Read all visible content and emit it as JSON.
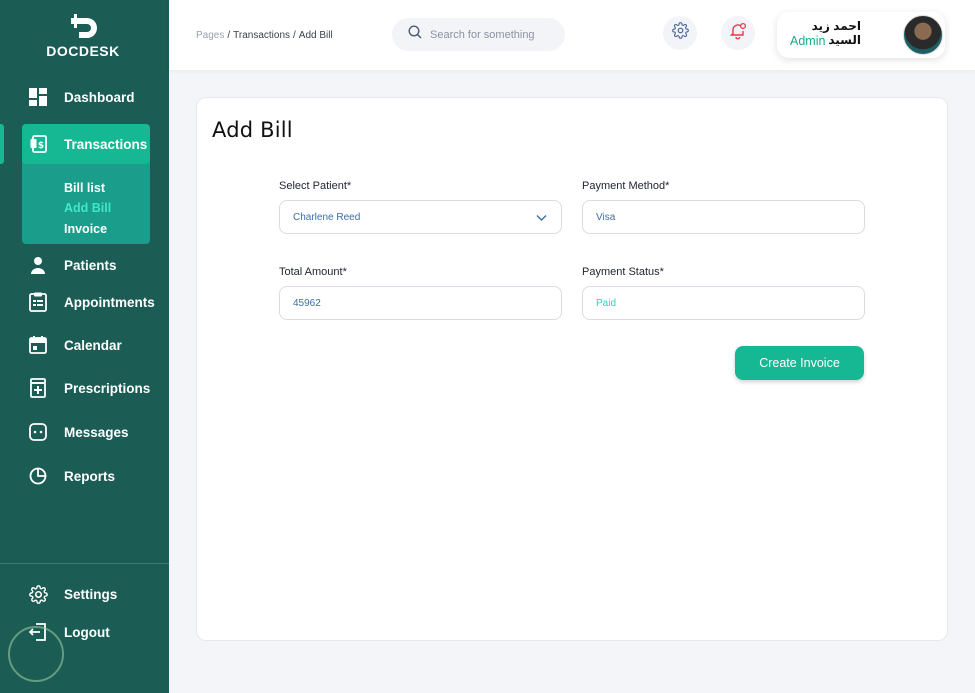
{
  "brand": {
    "name": "DOCDESK"
  },
  "sidebar": {
    "items": [
      {
        "label": "Dashboard",
        "icon": "dashboard-icon"
      },
      {
        "label": "Transactions",
        "icon": "transactions-icon"
      },
      {
        "label": "Patients",
        "icon": "user-icon"
      },
      {
        "label": "Appointments",
        "icon": "clipboard-icon"
      },
      {
        "label": "Calendar",
        "icon": "calendar-icon"
      },
      {
        "label": "Prescriptions",
        "icon": "prescription-icon"
      },
      {
        "label": "Messages",
        "icon": "message-icon"
      },
      {
        "label": "Reports",
        "icon": "pie-chart-icon"
      }
    ],
    "sub_items": [
      {
        "label": "Bill list"
      },
      {
        "label": "Add Bill"
      },
      {
        "label": "Invoice"
      }
    ],
    "bottom": [
      {
        "label": "Settings",
        "icon": "gear-icon"
      },
      {
        "label": "Logout",
        "icon": "logout-icon"
      }
    ],
    "active_item": "Transactions",
    "active_sub_item": "Add Bill"
  },
  "header": {
    "breadcrumb": [
      "Pages",
      "Transactions",
      "Add Bill"
    ],
    "search_placeholder": "Search for something",
    "user": {
      "name": "احمد زيد السيد",
      "role": "Admin"
    }
  },
  "form": {
    "title": "Add Bill",
    "patient": {
      "label": "Select Patient*",
      "value": "Charlene Reed"
    },
    "payment_method": {
      "label": "Payment Method*",
      "value": "Visa"
    },
    "total_amount": {
      "label": "Total Amount*",
      "value": "45962"
    },
    "payment_status": {
      "label": "Payment Status*",
      "value": "Paid"
    },
    "submit_label": "Create Invoice"
  },
  "colors": {
    "sidebar": "#1b5c55",
    "accent": "#16b894",
    "active_sub": "#3ee8c6"
  }
}
